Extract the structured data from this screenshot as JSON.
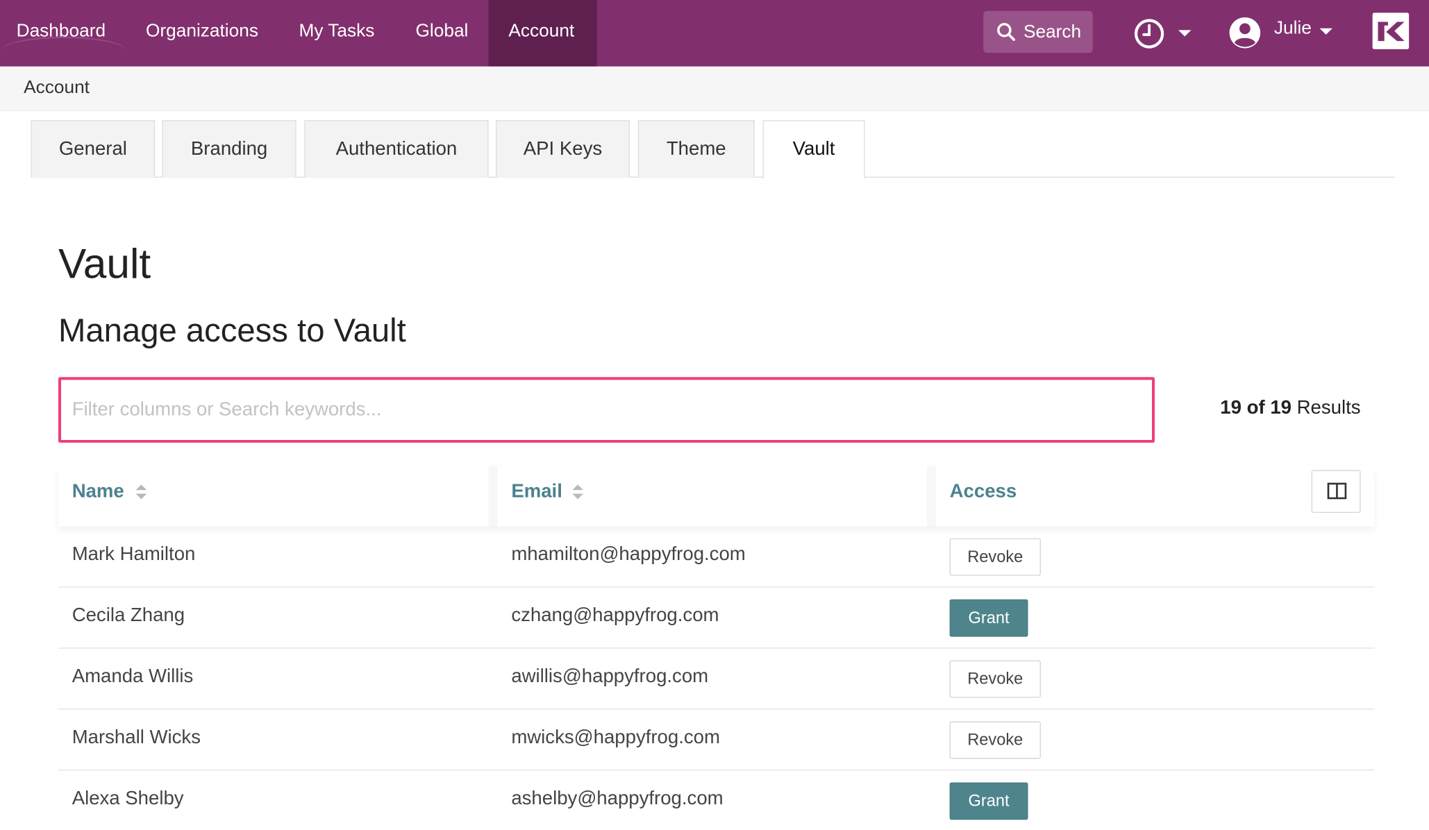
{
  "nav": {
    "items": [
      {
        "label": "Dashboard"
      },
      {
        "label": "Organizations"
      },
      {
        "label": "My Tasks"
      },
      {
        "label": "Global"
      },
      {
        "label": "Account"
      }
    ],
    "active": "Account",
    "search_label": "Search",
    "user_name": "Julie",
    "brand_color": "#822f6e",
    "active_color": "#5f2050"
  },
  "breadcrumb": "Account",
  "tabs": [
    {
      "label": "General"
    },
    {
      "label": "Branding"
    },
    {
      "label": "Authentication"
    },
    {
      "label": "API Keys"
    },
    {
      "label": "Theme"
    },
    {
      "label": "Vault"
    }
  ],
  "active_tab": "Vault",
  "page": {
    "title": "Vault",
    "subtitle": "Manage access to Vault"
  },
  "filter": {
    "placeholder": "Filter columns or Search keywords...",
    "value": ""
  },
  "results": {
    "shown": "19",
    "of_word": "of",
    "total": "19",
    "label": "Results"
  },
  "table": {
    "columns": [
      "Name",
      "Email",
      "Access"
    ],
    "rows": [
      {
        "name": "Mark Hamilton",
        "email": "mhamilton@happyfrog.com",
        "access": "Revoke"
      },
      {
        "name": "Cecila Zhang",
        "email": "czhang@happyfrog.com",
        "access": "Grant"
      },
      {
        "name": "Amanda Willis",
        "email": "awillis@happyfrog.com",
        "access": "Revoke"
      },
      {
        "name": "Marshall Wicks",
        "email": "mwicks@happyfrog.com",
        "access": "Revoke"
      },
      {
        "name": "Alexa Shelby",
        "email": "ashelby@happyfrog.com",
        "access": "Grant"
      }
    ]
  },
  "icons": {
    "search": "search-icon",
    "history": "clock-icon",
    "user": "user-circle-icon",
    "sort": "sort-icon",
    "columns": "columns-icon",
    "logo": "logo-icon"
  },
  "colors": {
    "filter_border": "#ee3d74",
    "header_text": "#4b828e",
    "grant_button": "#4e858c"
  }
}
